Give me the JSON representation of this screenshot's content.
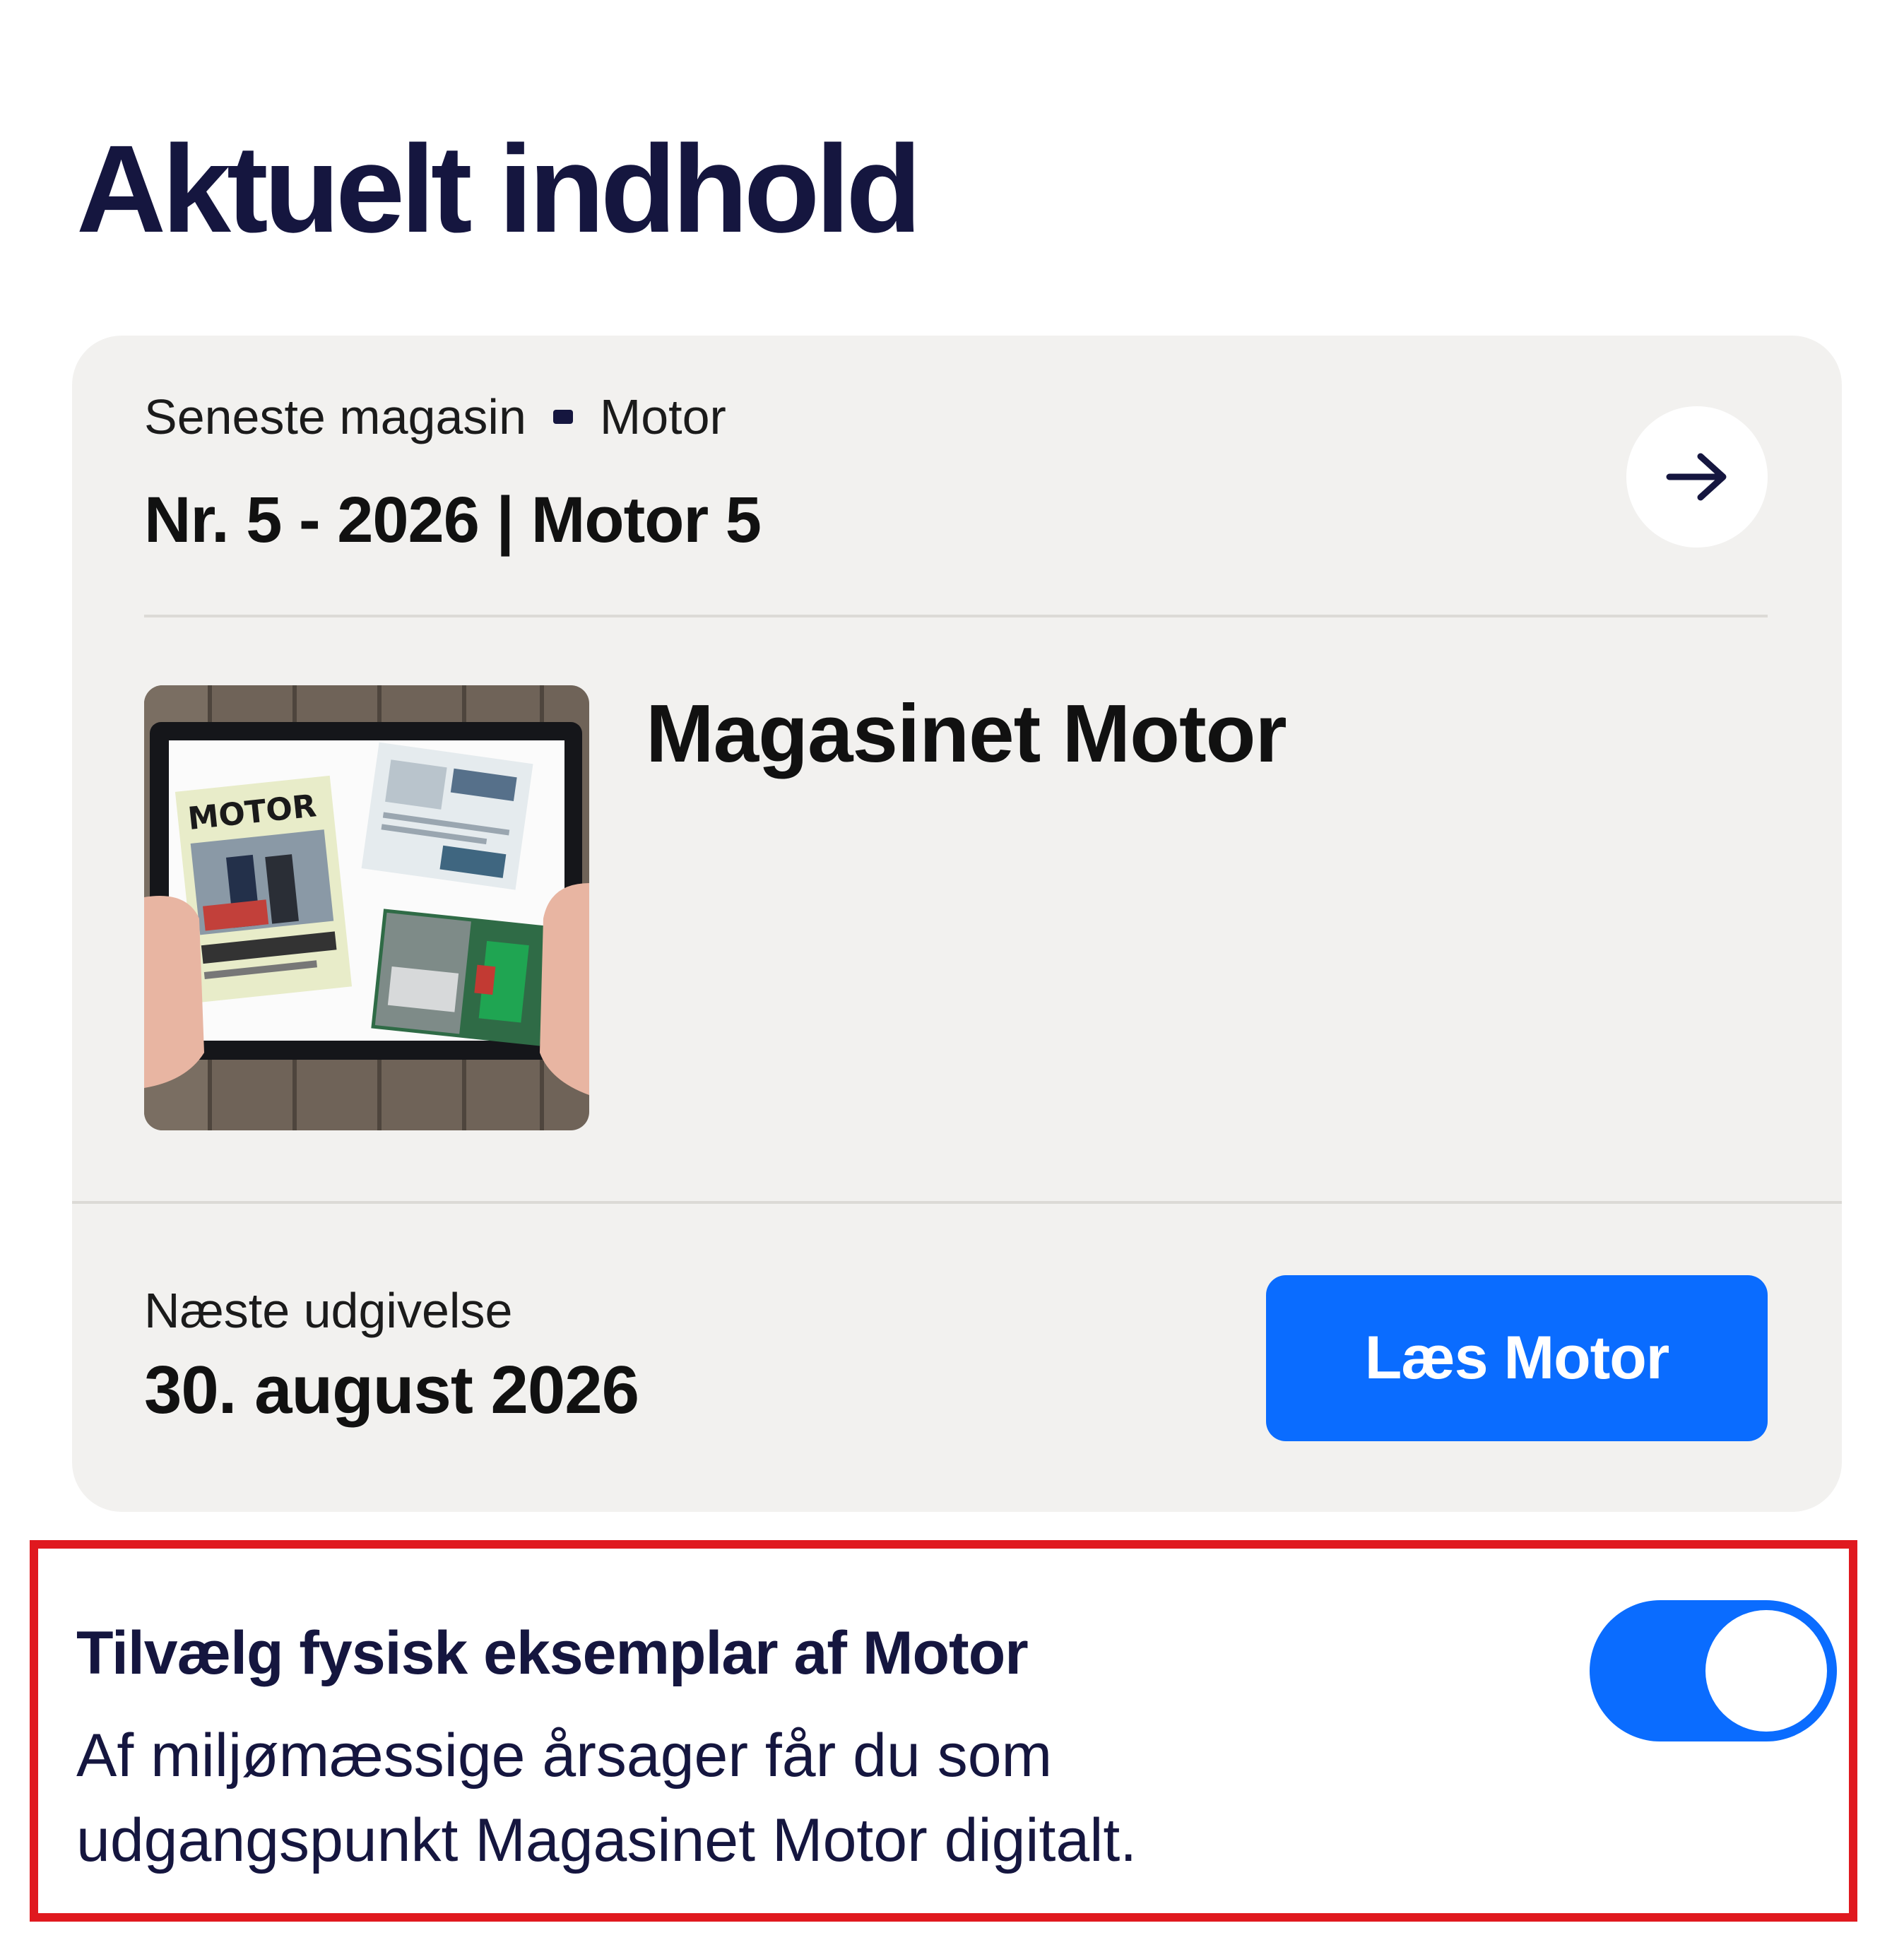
{
  "page": {
    "title": "Aktuelt indhold"
  },
  "latest": {
    "label": "Seneste magasin",
    "magazine": "Motor",
    "issue_title": "Nr. 5 - 2026 | Motor 5",
    "arrow_icon": "arrow-right-icon",
    "magazine_title": "Magasinet Motor",
    "cover_logo_text": "MOTOR"
  },
  "next": {
    "label": "Næste udgivelse",
    "date": "30. august 2026"
  },
  "read_button": {
    "label": "Læs Motor"
  },
  "physical_copy": {
    "title": "Tilvælg fysisk eksemplar af Motor",
    "description": "Af miljømæssige årsager får du som udgangspunkt Magasinet Motor digitalt.",
    "enabled": true
  },
  "colors": {
    "accent": "#0a6cff",
    "heading": "#15163f",
    "card_background": "#f2f1ef",
    "highlight": "#e0191f"
  }
}
